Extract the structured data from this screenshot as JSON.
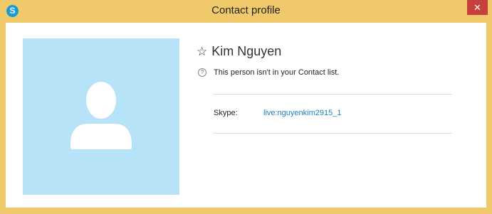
{
  "window": {
    "title": "Contact profile",
    "app_icon": "skype-icon",
    "close_label": "✕",
    "accent_color": "#f0c96a"
  },
  "profile": {
    "name": "Kim Nguyen",
    "favorite_icon": "star-outline-icon",
    "info_icon": "question-circle-icon",
    "info_text": "This person isn't in your Contact list.",
    "avatar_color": "#b7e3f8"
  },
  "details": [
    {
      "label": "Skype:",
      "value": "live:nguyenkim2915_1",
      "link_color": "#1a7fc0"
    }
  ]
}
